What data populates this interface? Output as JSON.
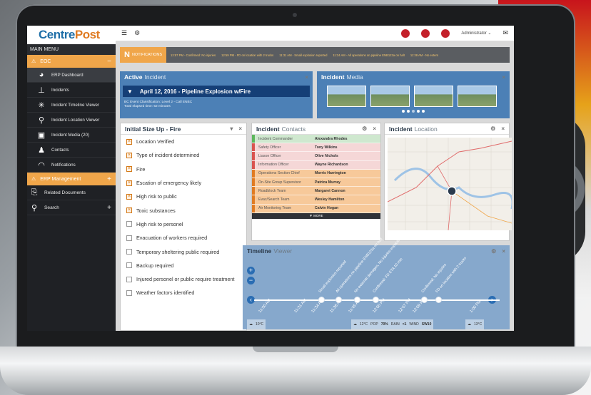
{
  "app": {
    "logo_left": "Centre",
    "logo_right": "Post"
  },
  "sidebar": {
    "main_menu_label": "MAIN MENU",
    "eoc_label": "EOC",
    "items": [
      {
        "label": "ERP Dashboard",
        "icon": "dashboard-icon"
      },
      {
        "label": "Incidents",
        "icon": "incidents-icon"
      },
      {
        "label": "Incident Timeline Viewer",
        "icon": "timeline-icon"
      },
      {
        "label": "Incident Location Viewer",
        "icon": "location-icon"
      },
      {
        "label": "Incident Media (20)",
        "icon": "media-icon"
      },
      {
        "label": "Contacts",
        "icon": "contacts-icon"
      },
      {
        "label": "Notifications",
        "icon": "notifications-icon"
      }
    ],
    "erp_management_label": "ERP Management",
    "related_documents_label": "Related Documents",
    "search_label": "Search"
  },
  "topbar": {
    "admin_label": "Administrator"
  },
  "notifications": {
    "label": "NOTIFICATIONS",
    "messages": [
      "12:57 PM - Confirmed: No injuries",
      "12:59 PM - FD on location with 2 trucks",
      "11:31 AM - Small explosion reported",
      "11:34 AM - All operations on pipeline ENB123a on halt",
      "11:38 AM - No extern"
    ]
  },
  "active_incident": {
    "title_bold": "Active",
    "title_light": "Incident",
    "name": "April 12, 2016 - Pipeline Explosion w/Fire",
    "classification": "BC Event Classification: Level 2 - Call ENBC",
    "elapsed": "Total elapsed time: 52 minutes"
  },
  "incident_media": {
    "title_bold": "Incident",
    "title_light": "Media"
  },
  "checklist": {
    "title": "Initial Size Up - Fire",
    "items": [
      {
        "label": "Location Verified",
        "checked": true
      },
      {
        "label": "Type of incident determined",
        "checked": true
      },
      {
        "label": "Fire",
        "checked": true
      },
      {
        "label": "Escation of emergency likely",
        "checked": true
      },
      {
        "label": "High risk to public",
        "checked": true
      },
      {
        "label": "Toxic substances",
        "checked": true
      },
      {
        "label": "High risk to personel",
        "checked": false
      },
      {
        "label": "Evacuation of workers required",
        "checked": false
      },
      {
        "label": "Temporary sheltering public required",
        "checked": false
      },
      {
        "label": "Backup required",
        "checked": false
      },
      {
        "label": "Injured personel or public require treatment",
        "checked": false
      },
      {
        "label": "Weather factors identified",
        "checked": false
      }
    ]
  },
  "contacts": {
    "title_bold": "Incident",
    "title_light": "Contacts",
    "more_label": "MORE",
    "rows": [
      {
        "role": "Incident Commander",
        "name": "Alexandra Rhodes",
        "bg": "#cfe8cf",
        "bar": "#5cb85c"
      },
      {
        "role": "Safety Officer",
        "name": "Tony Wilkins",
        "bg": "#f5d7d7",
        "bar": "#d9534f"
      },
      {
        "role": "Liason Officer",
        "name": "Olive Nichols",
        "bg": "#f5d7d7",
        "bar": "#d9534f"
      },
      {
        "role": "Information Officer",
        "name": "Wayne Richardson",
        "bg": "#f5d7d7",
        "bar": "#d9534f"
      },
      {
        "role": "Operations Section Chief",
        "name": "Morris Harrington",
        "bg": "#f7c99a",
        "bar": "#e07b22"
      },
      {
        "role": "On-Site Group Supervisor",
        "name": "Patrica Murray",
        "bg": "#f7c99a",
        "bar": "#e07b22"
      },
      {
        "role": "Roadblock Team",
        "name": "Margaret Cannon",
        "bg": "#f7c99a",
        "bar": "#e07b22"
      },
      {
        "role": "Evac/Search Team",
        "name": "Wesley Hamilton",
        "bg": "#f7c99a",
        "bar": "#e07b22"
      },
      {
        "role": "Air Monitoring Team",
        "name": "Calvin Hogan",
        "bg": "#f7c99a",
        "bar": "#e07b22"
      }
    ]
  },
  "location": {
    "title_bold": "Incident",
    "title_light": "Location"
  },
  "timeline": {
    "title_bold": "Timeline",
    "title_light": "Viewer",
    "ticks": [
      "11:00 AM",
      "11:31 AM",
      "11:34 AM",
      "11:38 AM",
      "11:45 AM",
      "12:00 PM",
      "12:07 PM",
      "12:09 PM",
      "1:00 PM"
    ],
    "events": [
      "Small explosion reported",
      "All operations on pipeline ENB123a on halt",
      "No external damages, No injuries expected",
      "Confirmed: FD ETA 10 min",
      "Confirmed: No injuries",
      "FD on location with 2 trucks"
    ],
    "weather": [
      {
        "temp": "10°C"
      },
      {
        "temp": "12°C",
        "pop_label": "POP",
        "pop": "70%",
        "rain_label": "RAIN",
        "rain": "<1",
        "wind_label": "WIND",
        "wind": "SW10"
      },
      {
        "temp": "13°C"
      }
    ]
  }
}
